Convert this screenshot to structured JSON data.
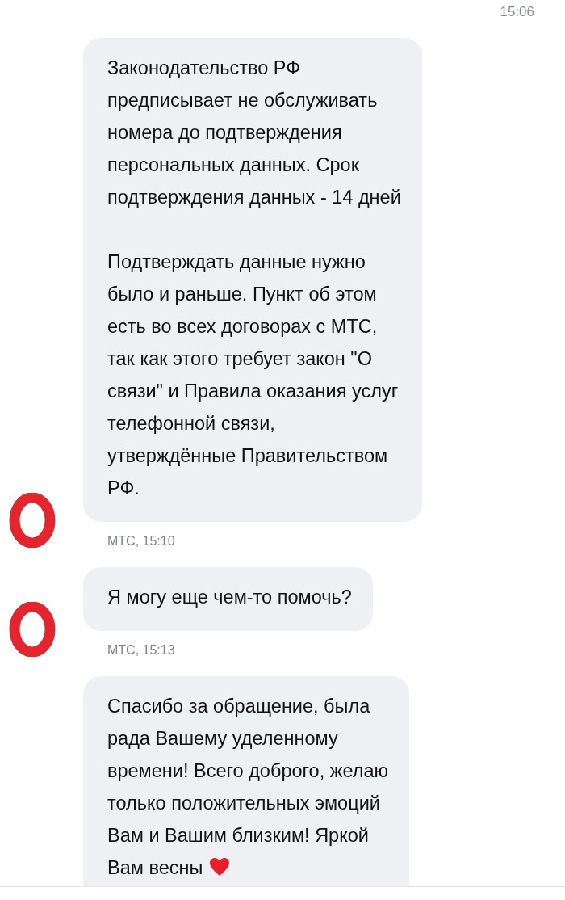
{
  "header": {
    "time": "15:06"
  },
  "messages": [
    {
      "text": "Законодательство РФ\nпредписывает не обслуживать\nномера до подтверждения\nперсональных данных. Срок\nподтверждения данных - 14 дней\n\nПодтверждать данные нужно\nбыло и раньше. Пункт об этом\nесть во всех договорах с МТС,\nтак как этого требует закон \"О\nсвязи\" и Правила оказания услуг\nтелефонной связи,\nутверждённые Правительством\nРФ.",
      "meta": "МТС, 15:10",
      "heart": false
    },
    {
      "text": "Я могу еще чем-то помочь?",
      "meta": "МТС, 15:13",
      "heart": false
    },
    {
      "text": "Спасибо за обращение, была\nрада Вашему уделенному\nвремени! Всего доброго, желаю\nтолько положительных эмоций\nВам и Вашим близким! Яркой\nВам весны",
      "heart": true
    }
  ]
}
